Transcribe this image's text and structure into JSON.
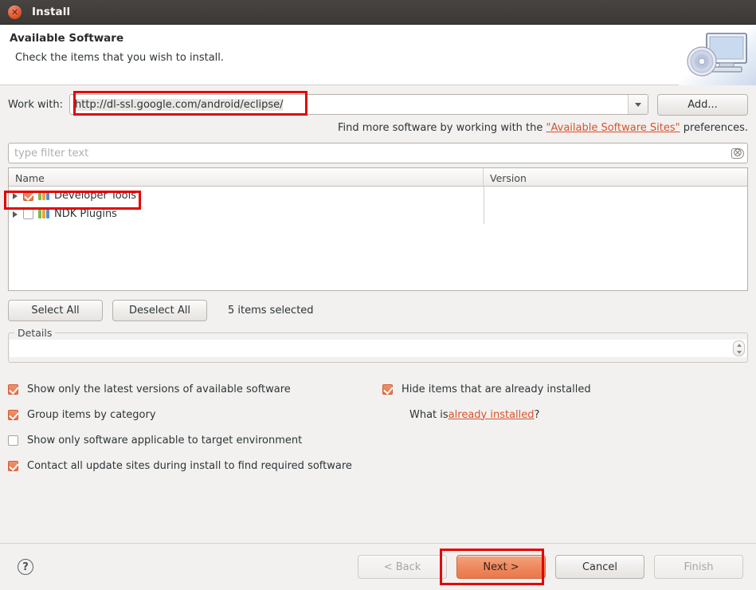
{
  "window": {
    "title": "Install",
    "close_icon": "close-icon"
  },
  "banner": {
    "heading": "Available Software",
    "subheading": "Check the items that you wish to install.",
    "icon": "install-monitor-cd-icon"
  },
  "work_with": {
    "label": "Work with:",
    "value": "http://dl-ssl.google.com/android/eclipse/",
    "dropdown_icon": "chevron-down-icon",
    "add_button": "Add..."
  },
  "hint": {
    "prefix": "Find more software by working with the ",
    "link": "\"Available Software Sites\"",
    "suffix": " preferences."
  },
  "filter": {
    "placeholder": "type filter text",
    "value": "",
    "clear_icon": "clear-text-icon"
  },
  "table": {
    "columns": [
      "Name",
      "Version"
    ],
    "rows": [
      {
        "name": "Developer Tools",
        "version": "",
        "checked": true,
        "expanded": false,
        "icon": "category-icon"
      },
      {
        "name": "NDK Plugins",
        "version": "",
        "checked": false,
        "expanded": false,
        "icon": "category-icon"
      }
    ]
  },
  "selection": {
    "select_all": "Select All",
    "deselect_all": "Deselect All",
    "status": "5 items selected"
  },
  "details": {
    "legend": "Details",
    "text": ""
  },
  "options_left": [
    {
      "label": "Show only the latest versions of available software",
      "checked": true
    },
    {
      "label": "Group items by category",
      "checked": true
    },
    {
      "label": "Show only software applicable to target environment",
      "checked": false
    },
    {
      "label": "Contact all update sites during install to find required software",
      "checked": true
    }
  ],
  "options_right": [
    {
      "label": "Hide items that are already installed",
      "checked": true
    }
  ],
  "what_is": {
    "prefix": "What is ",
    "link": "already installed",
    "suffix": "?"
  },
  "footer": {
    "help_icon": "help-icon",
    "back": "< Back",
    "next": "Next >",
    "cancel": "Cancel",
    "finish": "Finish"
  },
  "colors": {
    "accent": "#e8794c",
    "link": "#d9522a",
    "titlebar": "#3b3936",
    "annotation": "#e60000"
  }
}
